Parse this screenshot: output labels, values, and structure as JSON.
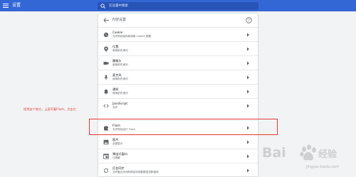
{
  "topbar": {
    "app_title": "设置",
    "search_placeholder": "在设置中搜索",
    "menu_icon": "menu-icon",
    "search_icon": "search-icon"
  },
  "content_settings": {
    "title": "内容设置",
    "back_icon": "arrow-back-icon",
    "help_icon": "help-icon",
    "rows": [
      {
        "title": "Cookie",
        "subtitle": "允许网站保存和读取 Cookie 数据",
        "icon": "cookie-icon"
      },
      {
        "title": "位置",
        "subtitle": "使用前先询问",
        "icon": "location-icon"
      },
      {
        "title": "摄像头",
        "subtitle": "使用前先询问",
        "icon": "camera-icon"
      },
      {
        "title": "麦克风",
        "subtitle": "使用前先询问",
        "icon": "microphone-icon"
      },
      {
        "title": "通知",
        "subtitle": "使用前先询问",
        "icon": "bell-icon"
      },
      {
        "title": "JavaScript",
        "subtitle": "允许",
        "icon": "code-icon"
      },
      {
        "title": "Flash",
        "subtitle": "允许网站运行 Flash",
        "icon": "puzzle-icon"
      },
      {
        "title": "图片",
        "subtitle": "全部显示",
        "icon": "image-icon"
      },
      {
        "title": "弹出式窗口",
        "subtitle": "已屏蔽",
        "icon": "popup-icon"
      },
      {
        "title": "后台同步",
        "subtitle": "允许最近关闭的网站完成数据发送和接收",
        "icon": "sync-icon"
      }
    ]
  },
  "annotation": "找到这个地方，上面写着Flash，点击它",
  "watermark": {
    "brand": "Bai",
    "brand2": "经验",
    "url": "jingyan.baidu.com"
  },
  "colors": {
    "topbar": "#3367d6",
    "highlight": "#e53935",
    "background": "#f1f3f4"
  }
}
